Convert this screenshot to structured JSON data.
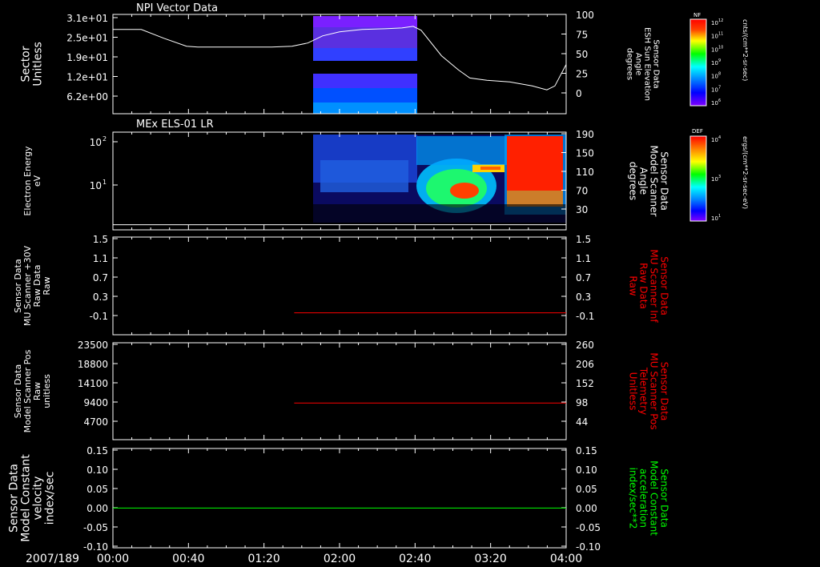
{
  "date_label": "2007/189",
  "time_ticks": [
    "00:00",
    "00:40",
    "01:20",
    "02:00",
    "02:40",
    "03:20",
    "04:00"
  ],
  "colors": {
    "background": "#000000",
    "axis": "#ffffff",
    "red_trace": "#ff0000",
    "green_trace": "#00ff00",
    "title_right_red": "#ff0000",
    "title_right_green": "#00ff00"
  },
  "chart_data": [
    {
      "type": "heatmap",
      "title": "NPI Vector Data",
      "ylabel_lines": [
        "Sector",
        "Unitless"
      ],
      "y_ticks": [
        "3.1e+01",
        "2.5e+01",
        "1.9e+01",
        "1.2e+01",
        "6.2e+00"
      ],
      "y2label_lines": [
        "Sensor Data",
        "ESH Sun Elevation",
        "Angle",
        "degrees"
      ],
      "y2_ticks": [
        "100",
        "75",
        "50",
        "25",
        "0"
      ],
      "y2lim": [
        -25,
        100
      ],
      "heat_block_time_range_hours": [
        1.7,
        2.67
      ],
      "overlay_line": {
        "name": "ESH Sun Elevation Angle",
        "x_hours": [
          0.0,
          0.25,
          0.45,
          0.65,
          0.75,
          1.0,
          1.4,
          1.58,
          1.72,
          1.85,
          2.0,
          2.2,
          2.4,
          2.55,
          2.65,
          2.72,
          2.9,
          3.05,
          3.15,
          3.3,
          3.5,
          3.7,
          3.83,
          3.9,
          4.0
        ],
        "y": [
          81,
          81,
          70,
          60,
          59,
          59,
          59,
          60,
          64,
          73,
          78,
          81,
          82,
          83,
          85,
          80,
          48,
          30,
          20,
          17,
          15,
          10,
          5,
          10,
          37
        ]
      },
      "colorbar": {
        "label": "NF",
        "units": "cnts/(cm**2-sr-sec)",
        "ticks": [
          "10",
          "10",
          "10",
          "10",
          "10",
          "10",
          "10"
        ],
        "exponents": [
          "12",
          "11",
          "10",
          "9",
          "8",
          "7",
          "6"
        ]
      }
    },
    {
      "type": "heatmap",
      "title": "MEx ELS-01 LR",
      "ylabel_lines": [
        "Electron Energy",
        "eV"
      ],
      "y_ticks": [
        "10",
        "10"
      ],
      "y_tick_exponents": [
        "2",
        "1"
      ],
      "y2label_lines": [
        "Sensor Data",
        "Model Scanner",
        "Angle",
        "degrees"
      ],
      "y2_ticks": [
        "190",
        "150",
        "110",
        "70",
        "30"
      ],
      "y2lim": [
        0,
        190
      ],
      "overlay_line": {
        "name": "Model Scanner Angle",
        "x_hours": [
          0.0,
          4.0
        ],
        "y": [
          10,
          10
        ]
      },
      "colorbar": {
        "label": "DEF",
        "units": "ergs/(cm**2-sr-sec-eV)",
        "ticks": [
          "10",
          "10",
          "10"
        ],
        "exponents": [
          "4",
          "3",
          "1"
        ]
      }
    },
    {
      "type": "line",
      "ylabel_lines": [
        "Sensor Data",
        "MU Scanner +30V",
        "Raw Data",
        "Raw"
      ],
      "y_ticks": [
        "1.5",
        "1.1",
        "0.7",
        "0.3",
        "-0.1"
      ],
      "ylim": [
        -0.5,
        1.5
      ],
      "y2label_lines": [
        "Sensor Data",
        "MU Scanner Inf",
        "Raw Data",
        "Raw"
      ],
      "y2_ticks": [
        "1.5",
        "1.1",
        "0.7",
        "0.3",
        "-0.1"
      ],
      "series": [
        {
          "x_hours": [
            1.6,
            4.0
          ],
          "values": [
            -0.05,
            -0.05
          ],
          "color": "#ff0000"
        }
      ]
    },
    {
      "type": "line",
      "ylabel_lines": [
        "Sensor Data",
        "Model Scanner Pos",
        "Raw",
        "unitless"
      ],
      "y_ticks": [
        "23500",
        "18800",
        "14100",
        "9400",
        "4700"
      ],
      "ylim": [
        0,
        23500
      ],
      "y2label_lines": [
        "Sensor Data",
        "MU Scanner Pos",
        "Telemetry",
        "Unitless"
      ],
      "y2_ticks": [
        "260",
        "206",
        "152",
        "98",
        "44"
      ],
      "y2lim": [
        0,
        260
      ],
      "series": [
        {
          "x_hours": [
            1.6,
            4.0
          ],
          "values": [
            8900,
            8900
          ],
          "color": "#ff0000"
        }
      ]
    },
    {
      "type": "line",
      "ylabel_lines": [
        "Sensor Data",
        "Model Constant",
        "velocity",
        "index/sec"
      ],
      "y_ticks": [
        "0.15",
        "0.10",
        "0.05",
        "0.00",
        "-0.05",
        "-0.10"
      ],
      "ylim": [
        -0.1,
        0.15
      ],
      "y2label_lines": [
        "Sensor Data",
        "Model Constant",
        "acceleration",
        "index/sec**2"
      ],
      "y2_ticks": [
        "0.15",
        "0.10",
        "0.05",
        "0.00",
        "-0.05",
        "-0.10"
      ],
      "series": [
        {
          "x_hours": [
            0.0,
            4.0
          ],
          "values": [
            0.0,
            0.0
          ],
          "color": "#00ff00"
        }
      ]
    }
  ]
}
